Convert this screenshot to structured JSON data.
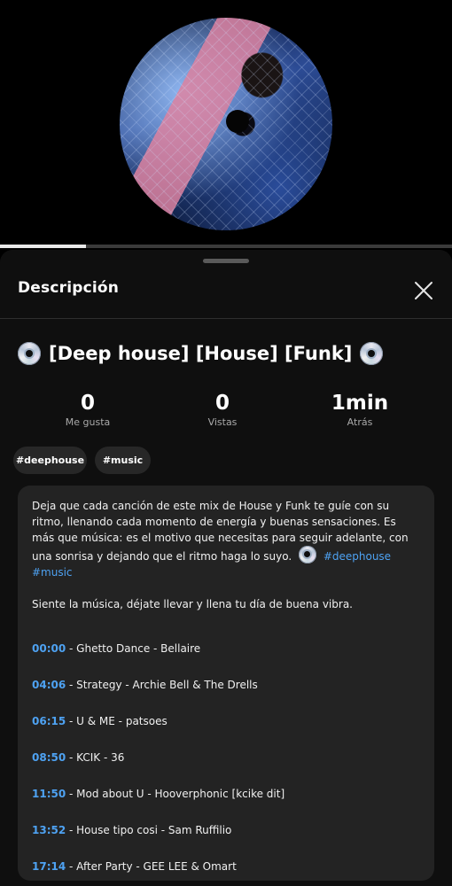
{
  "player": {
    "cover_icon": "vinyl-disc-artwork",
    "progress_fraction": 0.19
  },
  "sheet": {
    "title": "Descripción",
    "close_icon": "close-icon"
  },
  "video": {
    "title": "[Deep house] [House] [Funk]",
    "title_icon": "cd-icon"
  },
  "stats": [
    {
      "value": "0",
      "label": "Me gusta"
    },
    {
      "value": "0",
      "label": "Vistas"
    },
    {
      "value": "1min",
      "label": "Atrás"
    }
  ],
  "chips": [
    "#deephouse",
    "#music"
  ],
  "description": {
    "paragraph1": "Deja que cada canción de este mix de House y Funk te guíe con su ritmo, llenando cada momento de energía y buenas sensaciones. Es más que música: es el motivo que necesitas para seguir adelante, con una sonrisa y dejando que el ritmo haga lo suyo.",
    "hashtags": [
      "#deephouse",
      "#music"
    ],
    "paragraph2": "Siente la música, déjate llevar y llena tu día de buena vibra."
  },
  "tracks": [
    {
      "time": "00:00",
      "title": " - Ghetto Dance - Bellaire"
    },
    {
      "time": "04:06",
      "title": " - Strategy - Archie Bell & The Drells"
    },
    {
      "time": "06:15",
      "title": " - U & ME - patsoes"
    },
    {
      "time": "08:50",
      "title": " - KCIK - 36"
    },
    {
      "time": "11:50",
      "title": " - Mod about U - Hooverphonic [kcike dit]"
    },
    {
      "time": "13:52",
      "title": " - House tipo cosi - Sam Ruffilio"
    },
    {
      "time": "17:14",
      "title": " - After Party - GEE LEE & Omart"
    }
  ],
  "colors": {
    "accent_link": "#4ea2f2",
    "sheet_bg": "#0f0f0f",
    "card_bg": "#232323"
  }
}
